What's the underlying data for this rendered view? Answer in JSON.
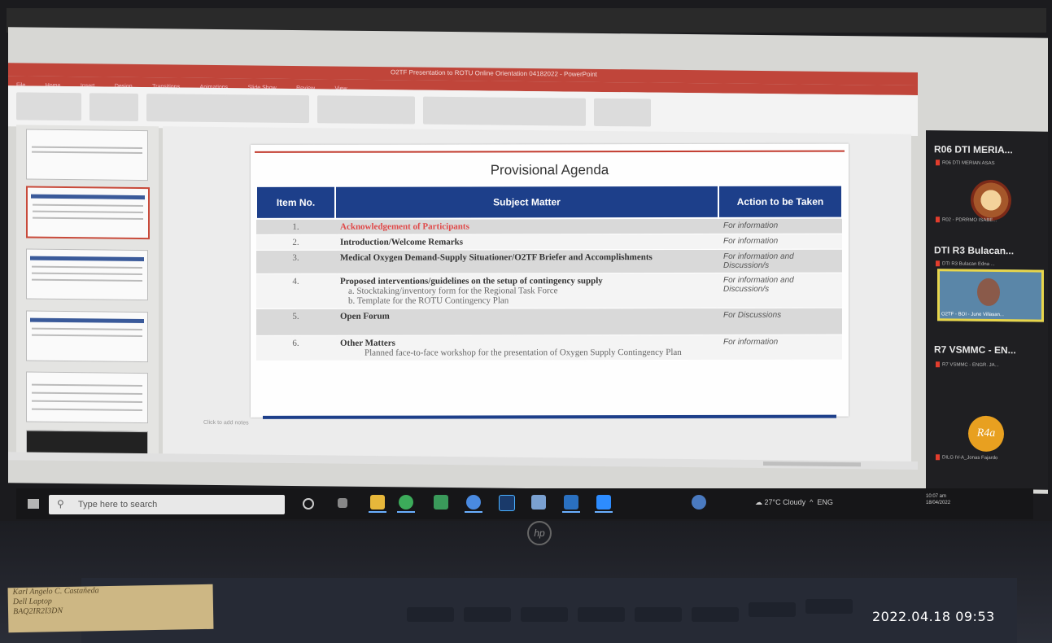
{
  "powerpoint": {
    "window_title": "O2TF Presentation to ROTU Online Orientation 04182022 - PowerPoint",
    "ribbon_tabs": [
      "File",
      "Home",
      "Insert",
      "Design",
      "Transitions",
      "Animations",
      "Slide Show",
      "Review",
      "View"
    ]
  },
  "slide": {
    "title": "Provisional Agenda",
    "headers": [
      "Item No.",
      "Subject Matter",
      "Action to be Taken"
    ],
    "rows": [
      {
        "num": "1.",
        "subject": "Acknowledgement of Participants",
        "action": "For information"
      },
      {
        "num": "2.",
        "subject": "Introduction/Welcome Remarks",
        "action": "For information"
      },
      {
        "num": "3.",
        "subject": "Medical Oxygen Demand-Supply Situationer/O2TF Briefer and Accomplishments",
        "action": "For information and Discussion/s"
      },
      {
        "num": "4.",
        "subject": "Proposed interventions/guidelines on the setup of contingency supply",
        "sub_a": "a.   Stocktaking/inventory form for the Regional Task Force",
        "sub_b": "b.   Template for the ROTU Contingency Plan",
        "action": "For information and Discussion/s"
      },
      {
        "num": "5.",
        "subject": "Open Forum",
        "action": "For Discussions"
      },
      {
        "num": "6.",
        "subject": "Other Matters",
        "sub_a": "Planned face-to-face workshop for the presentation of Oxygen Supply Contingency Plan",
        "action": "For information"
      }
    ]
  },
  "notes_placeholder": "Click to add notes",
  "participants": [
    {
      "name": "R06 DTI MERIA...",
      "sub": "R06 DTI MERIAN ASAS"
    },
    {
      "name": "",
      "sub": "R02 - PDRRMO ISABE..."
    },
    {
      "name": "DTI R3 Bulacan...",
      "sub": "DTI R3 Bulacan  Edna ..."
    },
    {
      "name": "",
      "sub": "O2TF - BOI - June Villasan..."
    },
    {
      "name": "R7 VSMMC - EN...",
      "sub": "R7 VSMMC - ENGR. JA..."
    },
    {
      "name": "",
      "sub": "DILG IV-A_Jonas Fajardo"
    }
  ],
  "avatar_text": "R4a",
  "taskbar": {
    "search_placeholder": "Type here to search",
    "weather": "27°C  Cloudy",
    "lang": "ENG",
    "time": "10:07 am",
    "date": "18/04/2022"
  },
  "laptop_brand": "hp",
  "sticker_lines": [
    "Karl Angelo C. Castañeda",
    "Dell Laptop",
    "BAQ2IR2I3DN"
  ],
  "timestamp": "2022.04.18 09:53",
  "colors": {
    "header_blue": "#1d3f8a",
    "accent_red": "#c23b2e",
    "ppt_red": "#c0453a"
  }
}
